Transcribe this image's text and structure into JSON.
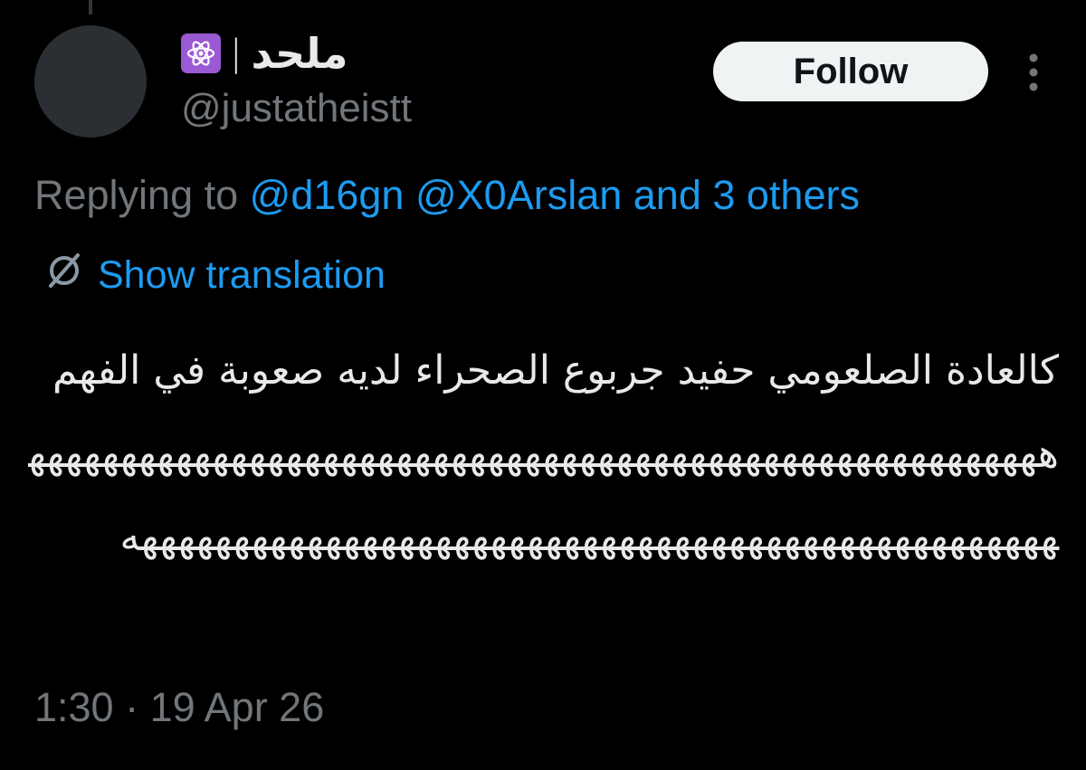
{
  "author": {
    "display_name": "ملحد",
    "separator": "|",
    "handle": "@justatheistt",
    "badge_icon": "atom-icon",
    "badge_color": "#9b59d4"
  },
  "actions": {
    "follow_label": "Follow",
    "more_icon": "more-vertical-icon"
  },
  "reply": {
    "prefix": "Replying to ",
    "mention_1": "@d16gn",
    "mention_2": "@X0Arslan",
    "others": "and 3 others"
  },
  "translation": {
    "icon": "globe-slash-icon",
    "label": "Show translation"
  },
  "body": {
    "text": "كالعادة الصلعومي حفيد جربوع الصحراء لديه صعوبة في الفهم ههههههههههههههههههههههههههههههههههههههههههههههههههههههههههههههههههههههههههههههههههههههههههههههههههههههههههه"
  },
  "meta": {
    "timestamp": "1:30 · 19 Apr 26"
  },
  "colors": {
    "background": "#000000",
    "text_primary": "#e7e9ea",
    "text_secondary": "#71767b",
    "accent": "#1d9bf0",
    "follow_bg": "#eff3f4"
  }
}
